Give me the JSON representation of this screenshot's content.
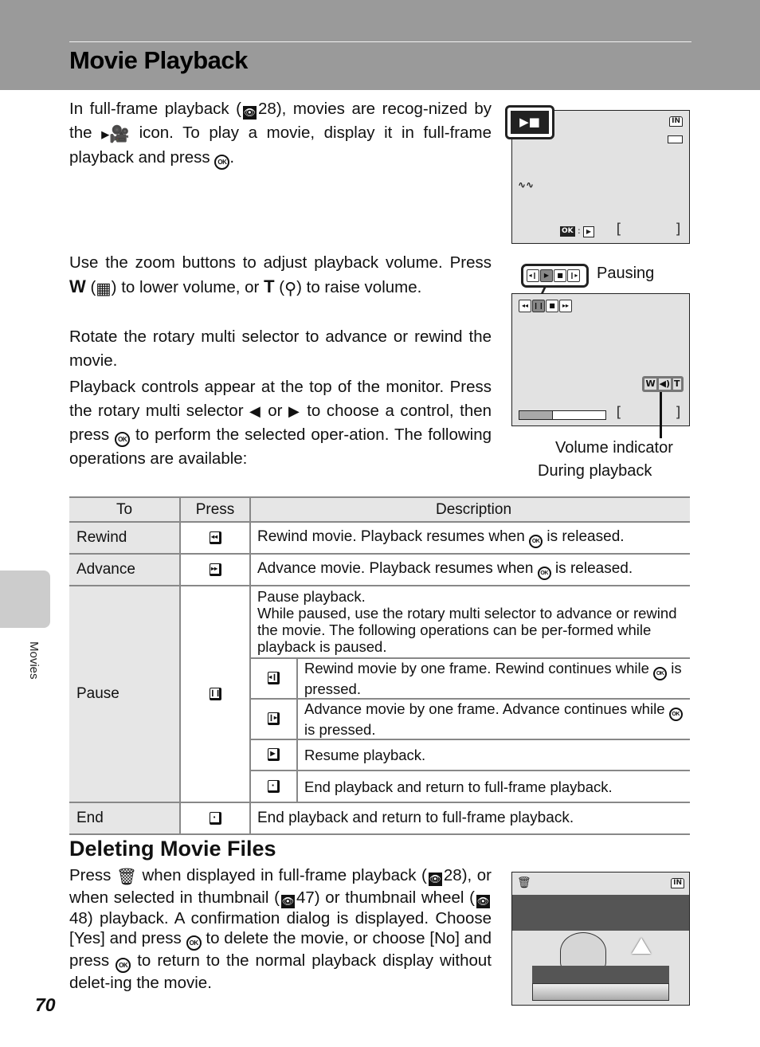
{
  "page": {
    "title": "Movie Playback",
    "side_tab_label": "Movies",
    "page_number": "70"
  },
  "intro": {
    "p1_a": "In full-frame playback (",
    "p1_ref": "28",
    "p1_b": "), movies are recog-nized by the",
    "p1_c": "icon. To play a movie, display it in full-frame playback and press",
    "p1_end": "."
  },
  "volume": {
    "p2_a": "Use the zoom buttons to adjust playback volume. Press",
    "w_key": "W",
    "p2_b": "to lower volume, or",
    "t_key": "T",
    "p2_c": "to raise volume.",
    "p3": "Rotate the rotary multi selector to advance or rewind the movie.",
    "p4_a": "Playback controls appear at the top of the monitor. Press the rotary multi selector",
    "p4_or": "or",
    "p4_b": "to choose a control, then press",
    "p4_c": "to perform the selected oper-ation. The following operations are available:"
  },
  "figures": {
    "pausing_label": "Pausing",
    "volume_indicator_label": "Volume indicator",
    "during_playback_label": "During playback",
    "playback_progress": 0.39,
    "ok_label": "OK",
    "in_label": "IN",
    "w_label": "W",
    "t_label": "T"
  },
  "icons": {
    "ref": "👁",
    "movie": "▸🎥",
    "ok": "OK",
    "trash": "🗑",
    "left_tri": "◀",
    "right_tri": "▶",
    "zoom_out": "▦",
    "zoom_in": "⚲",
    "rewind": "◂◂",
    "advance": "▸▸",
    "pause": "❙❙",
    "stop": "■",
    "play": "▶",
    "frame_back": "◂❙",
    "frame_fwd": "❙▸",
    "end": "▪"
  },
  "table": {
    "headers": {
      "to": "To",
      "press": "Press",
      "description": "Description"
    },
    "rows": [
      {
        "to": "Rewind",
        "press_icon": "rewind",
        "desc_a": "Rewind movie. Playback resumes when",
        "desc_b": "is released."
      },
      {
        "to": "Advance",
        "press_icon": "advance",
        "desc_a": "Advance movie. Playback resumes when",
        "desc_b": "is released."
      },
      {
        "to": "Pause",
        "press_icon": "pause",
        "desc_line1": "Pause playback.",
        "desc_line2": "While paused, use the rotary multi selector to advance or rewind the movie. The following operations can be per-formed while playback is paused.",
        "sub": [
          {
            "icon": "frame_back",
            "desc_a": "Rewind movie by one frame. Rewind continues while",
            "desc_b": "is pressed."
          },
          {
            "icon": "frame_fwd",
            "desc_a": "Advance movie by one frame. Advance continues while",
            "desc_b": "is pressed."
          },
          {
            "icon": "play",
            "desc": "Resume playback."
          },
          {
            "icon": "end",
            "desc": "End playback and return to full-frame playback."
          }
        ]
      },
      {
        "to": "End",
        "press_icon": "end",
        "desc": "End playback and return to full-frame playback."
      }
    ]
  },
  "deleting": {
    "heading": "Deleting Movie Files",
    "p_a": "Press",
    "p_b": "when displayed in full-frame playback (",
    "ref1": "28",
    "p_c": "), or when selected in thumbnail (",
    "ref2": "47",
    "p_d": ") or thumbnail wheel (",
    "ref3": "48",
    "p_e": ") playback. A confirmation dialog is displayed. Choose [Yes] and press",
    "p_f": "to delete the movie, or choose [No] and press",
    "p_g": "to return to the normal playback display without delet-ing the movie."
  }
}
